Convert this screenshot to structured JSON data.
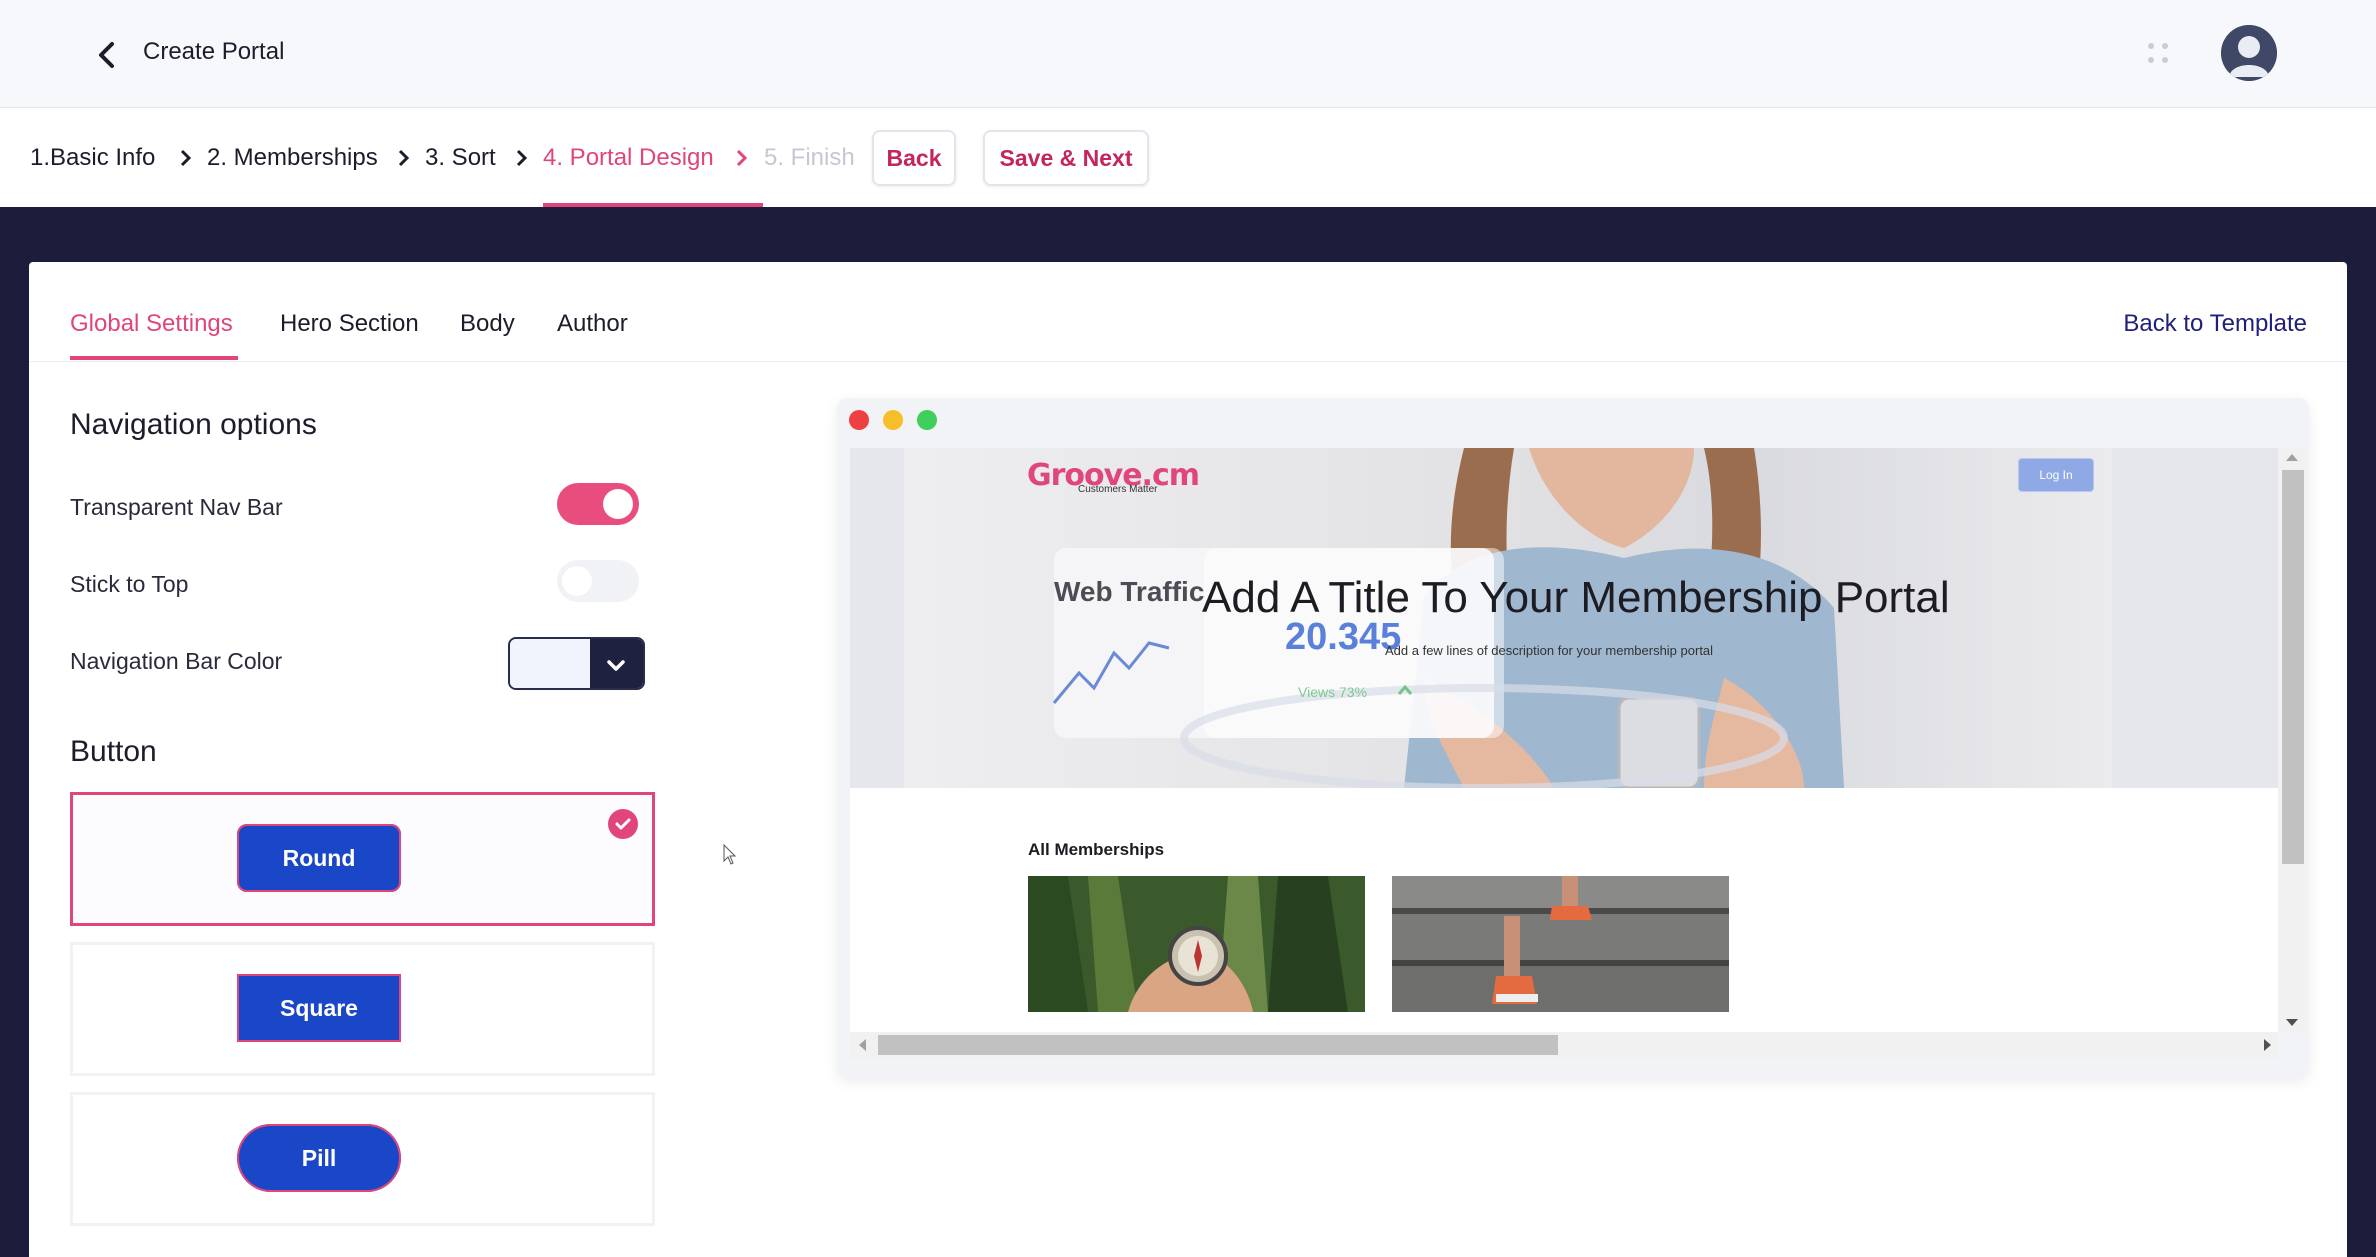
{
  "header": {
    "title": "Create Portal"
  },
  "stepper": {
    "steps": [
      {
        "label": "1.Basic Info",
        "state": "done"
      },
      {
        "label": "2. Memberships",
        "state": "done"
      },
      {
        "label": "3. Sort",
        "state": "done"
      },
      {
        "label": "4. Portal Design",
        "state": "active"
      },
      {
        "label": "5. Finish",
        "state": "disabled"
      }
    ],
    "back_label": "Back",
    "save_next_label": "Save & Next"
  },
  "tabs": {
    "items": [
      "Global Settings",
      "Hero Section",
      "Body",
      "Author"
    ],
    "active": "Global Settings",
    "back_to_template": "Back to Template"
  },
  "navigation": {
    "title": "Navigation options",
    "transparent_nav_bar": {
      "label": "Transparent Nav Bar",
      "on": true
    },
    "stick_to_top": {
      "label": "Stick to Top",
      "on": false
    },
    "nav_bar_color": {
      "label": "Navigation Bar Color",
      "value": "#f1f4fc"
    }
  },
  "button": {
    "title": "Button",
    "options": [
      {
        "label": "Round",
        "selected": true
      },
      {
        "label": "Square",
        "selected": false
      },
      {
        "label": "Pill",
        "selected": false
      }
    ]
  },
  "preview": {
    "logo_text": "Groove.cm",
    "logo_tagline": "Customers Matter",
    "login_label": "Log In",
    "hero_title": "Add A Title To Your Membership Portal",
    "hero_description": "Add a few lines of description for your membership portal",
    "hero_overlay": {
      "heading": "Web Traffic",
      "number": "20.345",
      "views": "Views 73%"
    },
    "memberships_title": "All Memberships"
  },
  "colors": {
    "accent_pink": "#e0457b",
    "brand_blue": "#1a46c8",
    "navy": "#1c1d3a",
    "link_navy": "#20207a"
  }
}
